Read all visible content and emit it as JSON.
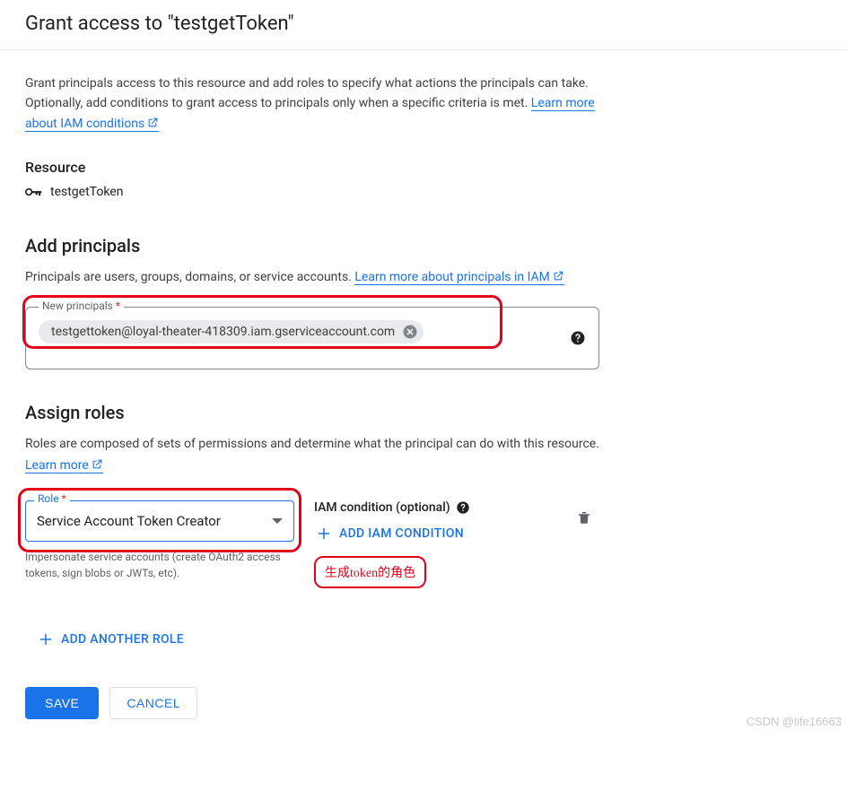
{
  "header": {
    "title": "Grant access to \"testgetToken\""
  },
  "intro": {
    "text": "Grant principals access to this resource and add roles to specify what actions the principals can take. Optionally, add conditions to grant access to principals only when a specific criteria is met. ",
    "link": "Learn more about IAM conditions"
  },
  "resource": {
    "heading": "Resource",
    "name": "testgetToken"
  },
  "principals": {
    "heading": "Add principals",
    "desc_prefix": "Principals are users, groups, domains, or service accounts. ",
    "link": "Learn more about principals in IAM",
    "field_label": "New principals",
    "chip_value": "testgettoken@loyal-theater-418309.iam.gserviceaccount.com"
  },
  "roles": {
    "heading": "Assign roles",
    "desc_prefix": "Roles are composed of sets of permissions and determine what the principal can do with this resource. ",
    "link": "Learn more",
    "role_label": "Role",
    "role_value": "Service Account Token Creator",
    "role_hint": "Impersonate service accounts (create OAuth2 access tokens, sign blobs or JWTs, etc).",
    "condition_label": "IAM condition (optional)",
    "add_condition": "ADD IAM CONDITION",
    "annotation": "生成token的角色",
    "add_another": "ADD ANOTHER ROLE"
  },
  "buttons": {
    "save": "SAVE",
    "cancel": "CANCEL"
  },
  "watermark": "CSDN @life16663"
}
